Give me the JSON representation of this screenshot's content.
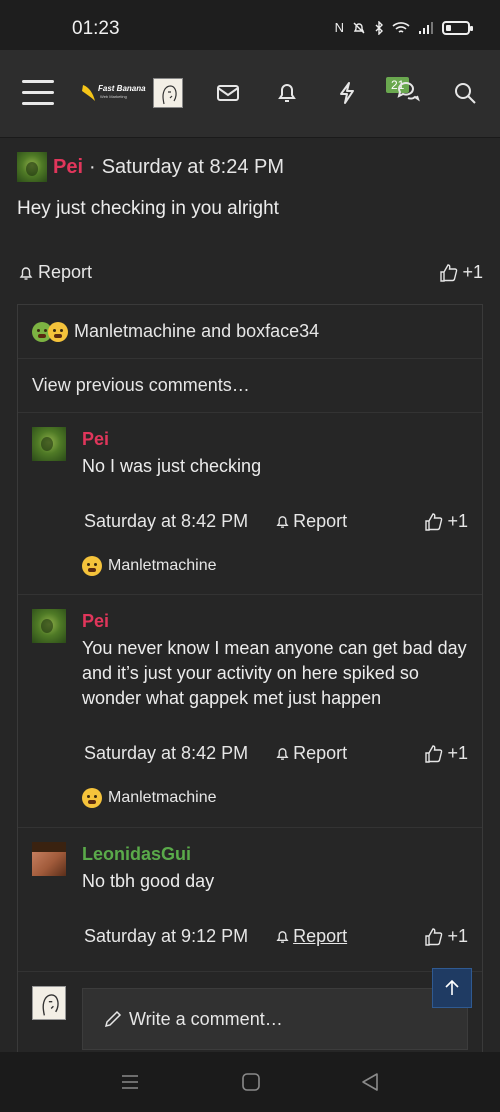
{
  "status_bar": {
    "time": "01:23"
  },
  "header": {
    "logo_text": "Fast Banana",
    "logo_subtext": "Web Marketing",
    "notification_count": "21"
  },
  "post": {
    "author": "Pei",
    "date": "Saturday at 8:24 PM",
    "separator": "·",
    "body": "Hey just checking in you alright",
    "report_label": "Report",
    "like_label": "+1"
  },
  "thread": {
    "reaction_names": "Manletmachine and boxface34",
    "view_previous": "View previous comments…",
    "comments": [
      {
        "author": "Pei",
        "text": "No I was just checking",
        "date": "Saturday at 8:42 PM",
        "report_label": "Report",
        "like_label": "+1",
        "reaction_name": "Manletmachine"
      },
      {
        "author": "Pei",
        "text": "You never know I mean anyone can get bad day and it’s just your activity on here spiked so wonder what gappek met just happen",
        "date": "Saturday at 8:42 PM",
        "report_label": "Report",
        "like_label": "+1",
        "reaction_name": "Manletmachine"
      },
      {
        "author": "LeonidasGui",
        "text": "No tbh good day",
        "date": "Saturday at 9:12 PM",
        "report_label": "Report",
        "like_label": "+1"
      }
    ],
    "reply_placeholder": "Write a comment…"
  },
  "colors": {
    "author_pei": "#e0365b",
    "author_leonidas": "#5aaa4a",
    "badge": "#6aa84f",
    "scroll_button": "#1f3b63"
  }
}
